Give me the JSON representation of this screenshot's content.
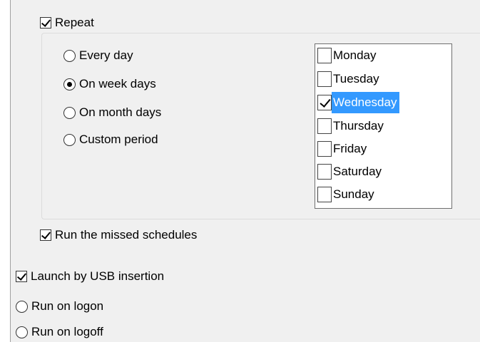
{
  "repeat": {
    "label": "Repeat",
    "checked": true
  },
  "repeat_options": [
    {
      "label": "Every day",
      "selected": false
    },
    {
      "label": "On week days",
      "selected": true
    },
    {
      "label": "On month days",
      "selected": false
    },
    {
      "label": "Custom period",
      "selected": false
    }
  ],
  "days": [
    {
      "label": "Monday",
      "checked": false,
      "highlighted": false
    },
    {
      "label": "Tuesday",
      "checked": false,
      "highlighted": false
    },
    {
      "label": "Wednesday",
      "checked": true,
      "highlighted": true
    },
    {
      "label": "Thursday",
      "checked": false,
      "highlighted": false
    },
    {
      "label": "Friday",
      "checked": false,
      "highlighted": false
    },
    {
      "label": "Saturday",
      "checked": false,
      "highlighted": false
    },
    {
      "label": "Sunday",
      "checked": false,
      "highlighted": false
    }
  ],
  "run_missed": {
    "label": "Run the missed schedules",
    "checked": true
  },
  "launch_usb": {
    "label": "Launch by USB insertion",
    "checked": true
  },
  "run_on_logon": {
    "label": "Run on logon",
    "selected": false
  },
  "run_on_logoff": {
    "label": "Run on logoff",
    "selected": false
  },
  "colors": {
    "panel": "#f0f0f0",
    "highlight": "#3399ff"
  }
}
